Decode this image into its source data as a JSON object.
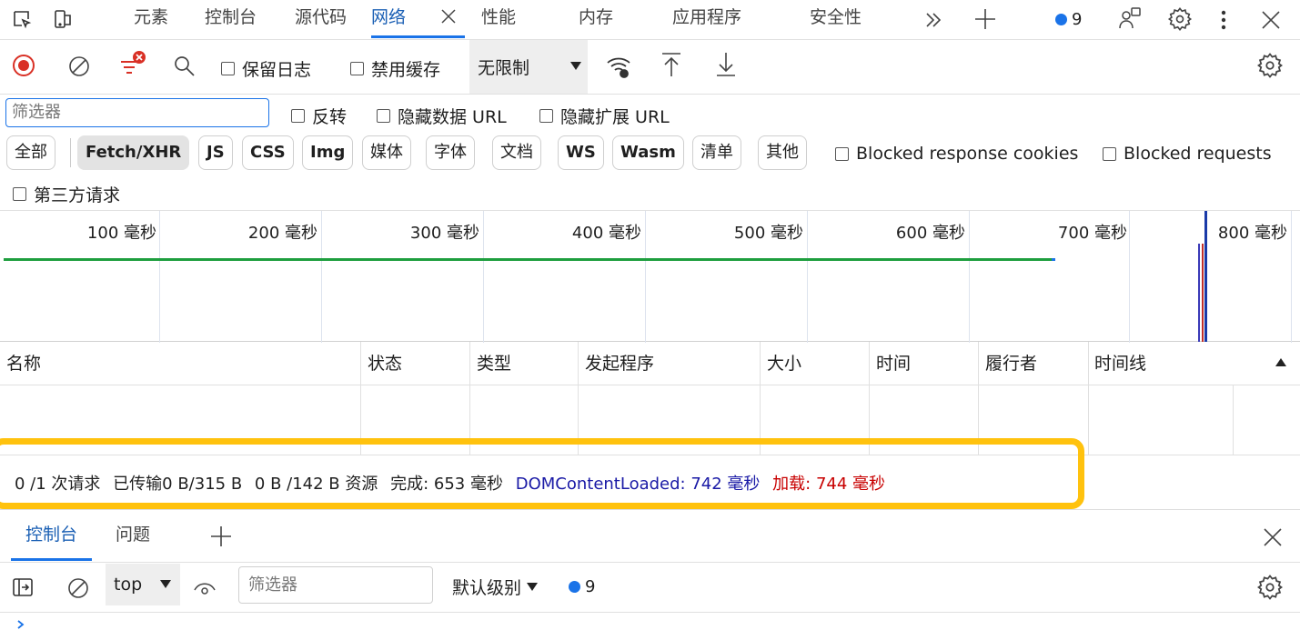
{
  "tabs": [
    {
      "label": "元素"
    },
    {
      "label": "控制台"
    },
    {
      "label": "源代码"
    },
    {
      "label": "网络"
    },
    {
      "label": "性能"
    },
    {
      "label": "内存"
    },
    {
      "label": "应用程序"
    },
    {
      "label": "安全性"
    }
  ],
  "issues_count": "9",
  "toolbar": {
    "preserve_log": "保留日志",
    "disable_cache": "禁用缓存",
    "throttle": "无限制"
  },
  "filter": {
    "placeholder": "筛选器",
    "invert": "反转",
    "hide_data_urls": "隐藏数据 URL",
    "hide_ext_urls": "隐藏扩展 URL"
  },
  "type_filters": [
    "全部",
    "Fetch/XHR",
    "JS",
    "CSS",
    "Img",
    "媒体",
    "字体",
    "文档",
    "WS",
    "Wasm",
    "清单",
    "其他"
  ],
  "selected_type": "Fetch/XHR",
  "blocked_cookies": "Blocked response cookies",
  "blocked_requests": "Blocked requests",
  "third_party": "第三方请求",
  "overview_ticks": [
    "100 毫秒",
    "200 毫秒",
    "300 毫秒",
    "400 毫秒",
    "500 毫秒",
    "600 毫秒",
    "700 毫秒",
    "800 毫秒"
  ],
  "columns": [
    "名称",
    "状态",
    "类型",
    "发起程序",
    "大小",
    "时间",
    "履行者",
    "时间线"
  ],
  "status": {
    "requests": "0 /1 次请求",
    "transferred": "已传输0 B/315 B",
    "resources": "0 B /142 B 资源",
    "finish": "完成: 653 毫秒",
    "dcl": "DOMContentLoaded: 742 毫秒",
    "load": "加载: 744 毫秒"
  },
  "drawer": {
    "tabs": [
      "控制台",
      "问题"
    ],
    "context": "top",
    "filter_placeholder": "筛选器",
    "level": "默认级别",
    "issues_count": "9"
  },
  "colors": {
    "accent": "#1a73e8",
    "highlight": "#ffc20e",
    "dcl": "#1a1aa6",
    "load": "#c80000",
    "record": "#d93025"
  }
}
